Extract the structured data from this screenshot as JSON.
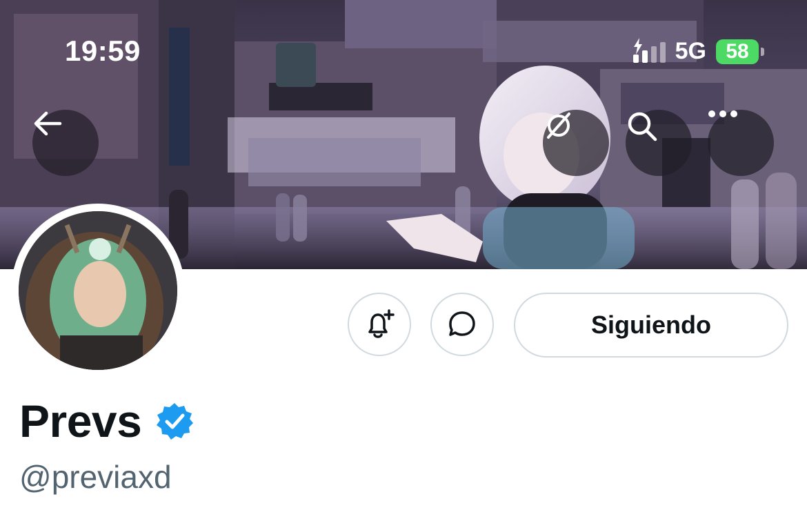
{
  "status_bar": {
    "time": "19:59",
    "network": "5G",
    "battery": "58"
  },
  "nav": {
    "back_icon": "arrow-left-icon",
    "grok_icon": "grok-slash-icon",
    "search_icon": "search-icon",
    "more_icon": "more-horizontal-icon"
  },
  "profile": {
    "display_name": "Prevs",
    "handle": "@previaxd",
    "verified": true
  },
  "actions": {
    "notify_icon": "bell-plus-icon",
    "message_icon": "message-bubble-icon",
    "follow_label": "Siguiendo"
  },
  "colors": {
    "verified_blue": "#1d9bf0",
    "text_primary": "#0f1419",
    "text_secondary": "#536471",
    "border": "#cfd9de",
    "battery_green": "#4cd964"
  }
}
